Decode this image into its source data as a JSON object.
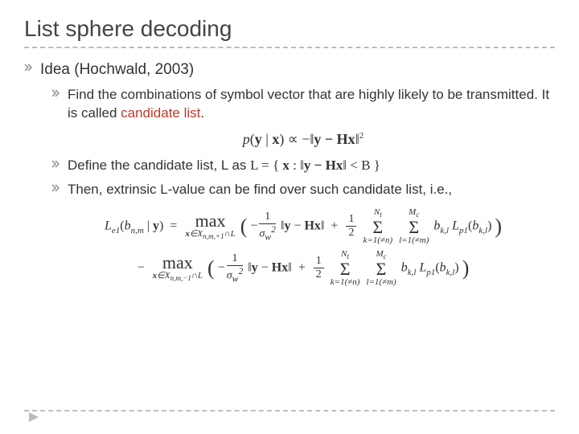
{
  "title": "List sphere decoding",
  "lvl1": {
    "idea": "Idea (Hochwald, 2003)"
  },
  "lvl2": {
    "find_pre": "Find the combinations of symbol vector that are highly likely to be transmitted. It is called ",
    "find_emph": "candidate list",
    "find_post": ".",
    "define_pre": "Define the candidate list, L as ",
    "then": "Then, extrinsic L-value can be find over such candidate list, i.e.,"
  },
  "formulas": {
    "f1_a": "p",
    "f1_b": "(",
    "f1_y": "y",
    "f1_bar": " | ",
    "f1_x": "x",
    "f1_c": ")",
    "f1_prop": " ∝ −",
    "f1_norm_l": "‖",
    "f1_ymhx": "y − Hx",
    "f1_norm_r": "‖",
    "f1_sq": "2",
    "l_def_a": "L = { ",
    "l_def_x": "x",
    "l_def_b": " : ",
    "l_def_norm_l": "‖",
    "l_def_ymhx": "y − Hx",
    "l_def_norm_r": "‖",
    "l_def_lt": " < B }",
    "big_line1_lhs": "L_{e1}(b_{n,m} | y) =",
    "big_line1_max1": "max over x ∈ X_{n,m,+1} ∩ L",
    "big_line1_body": "( −(1/σ_w²)‖y − Hx‖ + ½ Σ_{k=1(≠n)}^{N_t} Σ_{l=1(≠m)}^{M_c} b_{k,l} L_{p1}(b_{k,l}) )",
    "big_line2_minus": "−",
    "big_line2_max2": "max over x ∈ X_{n,m,−1} ∩ L",
    "big_line2_body": "( −(1/σ_w²)‖y − Hx‖ + ½ Σ_{k=1(≠n)}^{N_t} Σ_{l=1(≠m)}^{M_c} b_{k,l} L_{p1}(b_{k,l}) )"
  }
}
